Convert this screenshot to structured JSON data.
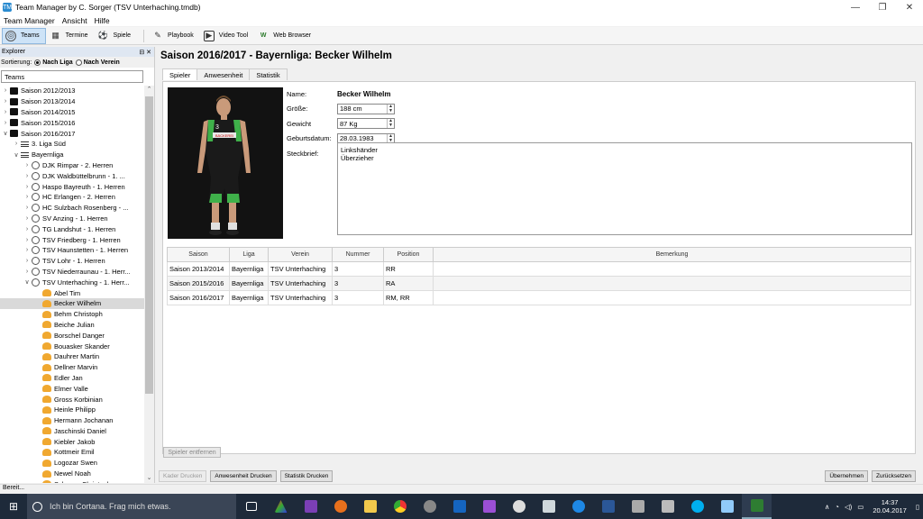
{
  "window": {
    "title": "Team Manager by C. Sorger (TSV Unterhaching.tmdb)",
    "app_icon": "TM"
  },
  "menu": [
    "Team Manager",
    "Ansicht",
    "Hilfe"
  ],
  "toolbar": {
    "teams": "Teams",
    "termine": "Termine",
    "spiele": "Spiele",
    "playbook": "Playbook",
    "video": "Video Tool",
    "web": "Web Browser"
  },
  "explorer": {
    "header": "Explorer",
    "sort_label": "Sortierung:",
    "sort_liga": "Nach Liga",
    "sort_verein": "Nach Verein",
    "tree_header": "Teams",
    "seasons": [
      "Saison 2012/2013",
      "Saison 2013/2014",
      "Saison 2014/2015",
      "Saison 2015/2016",
      "Saison 2016/2017"
    ],
    "leagues": [
      "3. Liga Süd",
      "Bayernliga"
    ],
    "teams": [
      "DJK Rimpar - 2. Herren",
      "DJK Waldbüttelbrunn - 1. ...",
      "Haspo Bayreuth - 1. Herren",
      "HC Erlangen - 2. Herren",
      "HC Sulzbach Rosenberg - ...",
      "SV Anzing - 1. Herren",
      "TG Landshut - 1. Herren",
      "TSV Friedberg - 1. Herren",
      "TSV Haunstetten - 1. Herren",
      "TSV Lohr - 1. Herren",
      "TSV Niederraunau - 1. Herr...",
      "TSV Unterhaching - 1. Herr..."
    ],
    "players": [
      "Abel Tim",
      "Becker Wilhelm",
      "Behm Christoph",
      "Beiche Julian",
      "Borschel Danger",
      "Bouasker Skander",
      "Dauhrer Martin",
      "Dellner Marvin",
      "Edler Jan",
      "Elmer Valle",
      "Gross Korbinian",
      "Heinle Philipp",
      "Hermann Jochanan",
      "Jaschinski Daniel",
      "Kiebler Jakob",
      "Kottmeir Emil",
      "Logozar Swen",
      "Newel Noah",
      "Schwarz Christoph"
    ]
  },
  "main": {
    "title": "Saison 2016/2017 - Bayernliga:  Becker Wilhelm",
    "tabs": [
      "Spieler",
      "Anwesenheit",
      "Statistik"
    ],
    "photo_sponsor": "BÄCKEREI",
    "photo_number": "3",
    "form": {
      "name_label": "Name:",
      "name_value": "Becker Wilhelm",
      "size_label": "Größe:",
      "size_value": "188 cm",
      "weight_label": "Gewicht",
      "weight_value": "87 Kg",
      "birth_label": "Geburtsdatum:",
      "birth_value": "28.03.1983",
      "bio_label": "Steckbrief:",
      "bio_line1": "Linkshänder",
      "bio_line2": "Überzieher"
    },
    "table": {
      "headers": [
        "Saison",
        "Liga",
        "Verein",
        "Nummer",
        "Position",
        "Bemerkung"
      ],
      "rows": [
        [
          "Saison 2013/2014",
          "Bayernliga",
          "TSV Unterhaching",
          "3",
          "RR",
          ""
        ],
        [
          "Saison 2015/2016",
          "Bayernliga",
          "TSV Unterhaching",
          "3",
          "RA",
          ""
        ],
        [
          "Saison 2016/2017",
          "Bayernliga",
          "TSV Unterhaching",
          "3",
          "RM, RR",
          ""
        ]
      ]
    },
    "remove_button": "Spieler entfernen"
  },
  "bottom": {
    "kader": "Kader Drucken",
    "anwesenheit": "Anwesenheit Drucken",
    "statistik": "Statistik Drucken",
    "save": "Übernehmen",
    "reset": "Zurücksetzen"
  },
  "status": "Bereit...",
  "taskbar": {
    "search": "Ich bin Cortana. Frag mich etwas.",
    "time": "14:37",
    "date": "20.04.2017"
  }
}
